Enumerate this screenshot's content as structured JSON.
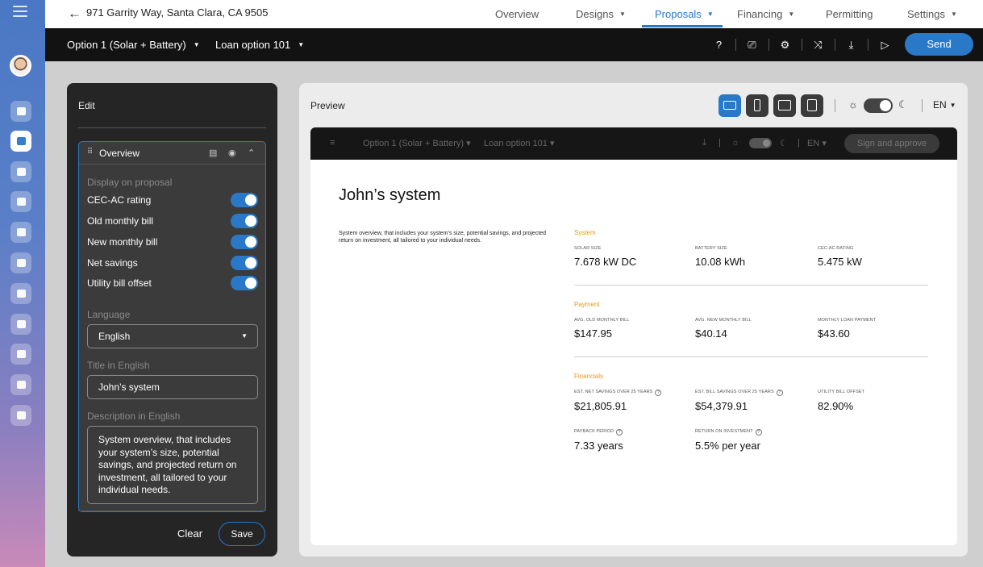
{
  "header": {
    "address": "971 Garrity Way, Santa Clara, CA 9505",
    "nav": [
      {
        "label": "Overview",
        "dropdown": false
      },
      {
        "label": "Designs",
        "dropdown": true
      },
      {
        "label": "Proposals",
        "dropdown": true,
        "active": true
      },
      {
        "label": "Financing",
        "dropdown": true
      },
      {
        "label": "Permitting",
        "dropdown": false
      },
      {
        "label": "Settings",
        "dropdown": true
      }
    ]
  },
  "toolbar": {
    "option_select": "Option 1 (Solar + Battery)",
    "loan_select": "Loan option 101",
    "send_label": "Send",
    "icons": [
      "help-icon",
      "presentation-icon",
      "settings-icon",
      "compare-icon",
      "download-icon",
      "play-icon"
    ]
  },
  "sidebar": {
    "icons": [
      "menu-icon",
      "avatar",
      "dashboard-icon",
      "projects-icon",
      "analytics-icon",
      "settings-icon",
      "team-icon",
      "billing-icon",
      "document-icon",
      "calendar-icon",
      "file-icon",
      "help-icon",
      "logout-icon"
    ]
  },
  "edit": {
    "header": "Edit",
    "section_title": "Overview",
    "display_label": "Display on proposal",
    "toggles": [
      {
        "label": "CEC-AC rating",
        "on": true
      },
      {
        "label": "Old monthly bill",
        "on": true
      },
      {
        "label": "New monthly bill",
        "on": true
      },
      {
        "label": "Net savings",
        "on": true
      },
      {
        "label": "Utility bill offset",
        "on": true
      }
    ],
    "language_label": "Language",
    "language_value": "English",
    "title_label": "Title in English",
    "title_value": "John’s system",
    "description_label": "Description in English",
    "description_value": "System overview, that includes your system’s size, potential savings, and projected return on investment, all tailored to your individual needs.",
    "clear_label": "Clear",
    "save_label": "Save"
  },
  "preview": {
    "header": "Preview",
    "lang": "EN",
    "frame": {
      "option_select": "Option 1 (Solar + Battery)",
      "loan_select": "Loan option 101",
      "lang": "EN",
      "sign_button": "Sign and approve",
      "title": "John’s system",
      "description": "System overview, that includes your system’s size, potential savings, and projected return on investment, all tailored to your individual needs.",
      "system": {
        "label": "System",
        "solar_size_label": "Solar size",
        "solar_size": "7.678 kW DC",
        "battery_size_label": "Battery size",
        "battery_size": "10.08 kWh",
        "cec_label": "CEC-AC rating",
        "cec": "5.475 kW"
      },
      "payment": {
        "label": "Payment",
        "old_bill_label": "Avg. old monthly bill",
        "old_bill": "$147.95",
        "new_bill_label": "Avg. new monthly bill",
        "new_bill": "$40.14",
        "loan_label": "Monthly loan payment",
        "loan": "$43.60"
      },
      "financials": {
        "label": "Financials",
        "net_savings_label": "Est. net savings over 25 years",
        "net_savings": "$21,805.91",
        "bill_savings_label": "Est. bill savings over 25 years",
        "bill_savings": "$54,379.91",
        "offset_label": "Utility bill offset",
        "offset": "82.90%",
        "payback_label": "Payback period",
        "payback": "7.33 years",
        "roi_label": "Return on investment",
        "roi": "5.5% per year"
      }
    }
  }
}
